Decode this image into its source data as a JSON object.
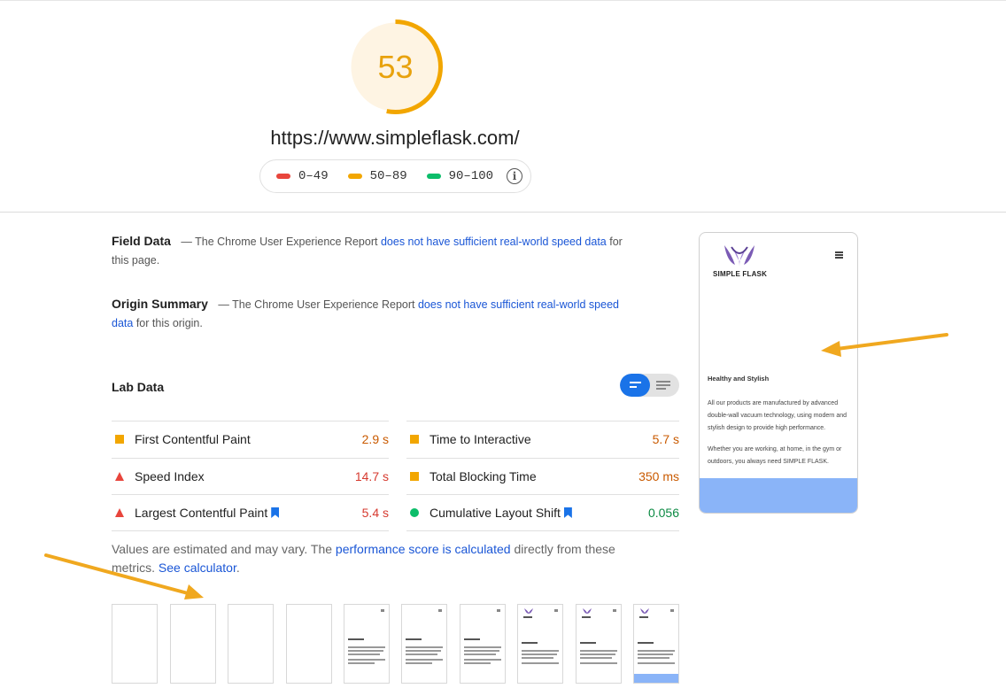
{
  "score": {
    "value": "53",
    "fraction": 0.53,
    "color": "#e8a20d",
    "background": "#fef4e3"
  },
  "url": "https://www.simpleflask.com/",
  "legend": {
    "items": [
      {
        "label": "0–49",
        "color": "#e8453c"
      },
      {
        "label": "50–89",
        "color": "#f2a600"
      },
      {
        "label": "90–100",
        "color": "#0cbd6a"
      }
    ],
    "info_icon": "info-icon"
  },
  "field_data": {
    "title": "Field Data",
    "prefix": "— The Chrome User Experience Report",
    "link": "does not have sufficient real-world speed data",
    "suffix": "for this page."
  },
  "origin_summary": {
    "title": "Origin Summary",
    "prefix": "— The Chrome User Experience Report",
    "link": "does not have sufficient real-world speed data",
    "suffix": "for this origin."
  },
  "lab_data": {
    "title": "Lab Data",
    "toggle_icons": [
      "compact-view-icon",
      "expanded-view-icon"
    ],
    "metrics_left": [
      {
        "name": "First Contentful Paint",
        "value": "2.9 s",
        "status": "average",
        "bookmark": false
      },
      {
        "name": "Speed Index",
        "value": "14.7 s",
        "status": "fail",
        "bookmark": false
      },
      {
        "name": "Largest Contentful Paint",
        "value": "5.4 s",
        "status": "fail",
        "bookmark": true
      }
    ],
    "metrics_right": [
      {
        "name": "Time to Interactive",
        "value": "5.7 s",
        "status": "average",
        "bookmark": false
      },
      {
        "name": "Total Blocking Time",
        "value": "350 ms",
        "status": "average",
        "bookmark": false
      },
      {
        "name": "Cumulative Layout Shift",
        "value": "0.056",
        "status": "pass",
        "bookmark": true
      }
    ]
  },
  "note": {
    "text1": "Values are estimated and may vary. The",
    "link1": "performance score is calculated",
    "text2": "directly from these metrics.",
    "link2": "See calculator",
    "text3": "."
  },
  "filmstrip": {
    "frame_count": 10
  },
  "phone": {
    "brand": "SIMPLE FLASK",
    "heading": "Healthy and Stylish",
    "p1": "All our products are manufactured by advanced double-wall vacuum technology, using modern and stylish design to provide high performance.",
    "p2": "Whether you are working, at home, in the gym or outdoors, you always need SIMPLE FLASK."
  },
  "colors": {
    "accent_blue": "#1a73e8",
    "link_blue": "#1a56d6",
    "annotation_arrow": "#f0a81f"
  }
}
